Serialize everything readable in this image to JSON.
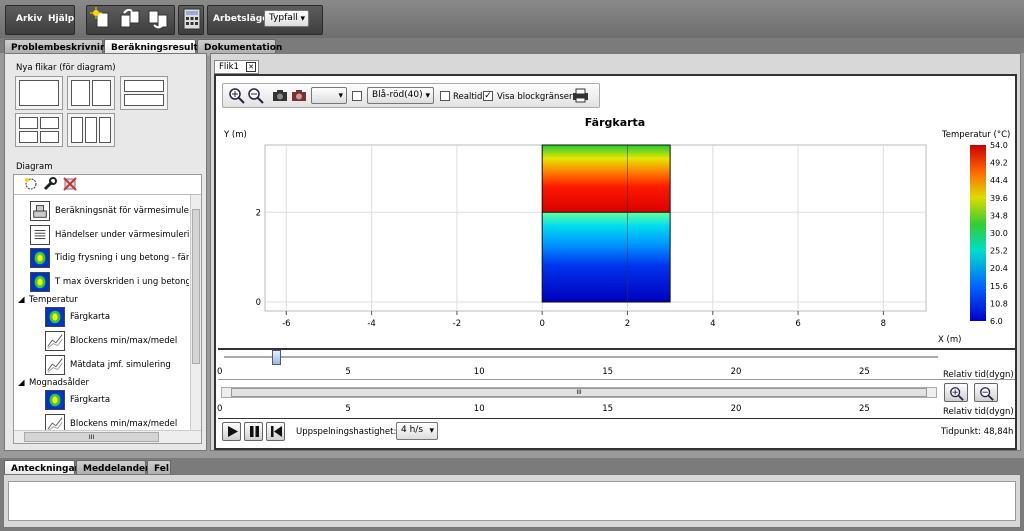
{
  "menu": {
    "arkiv": "Arkiv",
    "hjalp": "Hjälp",
    "arbetslage_label": "Arbetsläge:",
    "arbetslage_value": "Typfall"
  },
  "main_tabs": [
    {
      "label": "Problembeskrivning"
    },
    {
      "label": "Beräkningsresultat"
    },
    {
      "label": "Dokumentation"
    }
  ],
  "left": {
    "new_tabs_title": "Nya flikar (för diagram)",
    "diagram_title": "Diagram",
    "items": [
      {
        "label": "Beräkningsnät för värmesimulerin"
      },
      {
        "label": "Händelser under värmesimulering"
      },
      {
        "label": "Tidig frysning i ung betong - färgk"
      },
      {
        "label": "T max överskriden i ung betong -"
      }
    ],
    "cat_temp": "Temperatur",
    "temp_items": [
      {
        "label": "Färgkarta"
      },
      {
        "label": "Blockens min/max/medel"
      },
      {
        "label": "Mätdata jmf. simulering"
      }
    ],
    "cat_mogn": "Mognadsålder",
    "mogn_items": [
      {
        "label": "Färgkarta"
      },
      {
        "label": "Blockens min/max/medel"
      }
    ],
    "hscroll_grip": "III"
  },
  "doc_tab": {
    "label": "Flik1",
    "close": "✕"
  },
  "chart_toolbar": {
    "palette": "Blå-röd(40)",
    "realtid": "Realtid",
    "visa_block": "Visa blockgränser"
  },
  "chart_data": {
    "type": "heatmap",
    "title": "Färgkarta",
    "xlabel": "X (m)",
    "ylabel": "Y (m)",
    "xlim": [
      -6.5,
      9
    ],
    "ylim": [
      -0.2,
      3.5
    ],
    "x_ticks": [
      "-6",
      "-4",
      "-2",
      "0",
      "2",
      "4",
      "6",
      "8"
    ],
    "y_ticks": [
      "0",
      "2"
    ],
    "legend_title": "Temperatur (°C)",
    "legend_ticks": [
      "54.0",
      "49.2",
      "44.4",
      "39.6",
      "34.8",
      "30.0",
      "25.2",
      "20.4",
      "15.6",
      "10.8",
      "6.0"
    ],
    "block": {
      "x0": 0,
      "x1": 3,
      "y0": 0,
      "y1": 3.5,
      "vline_x": 2,
      "hline_y": 2
    }
  },
  "timeline": {
    "ticks": [
      "0",
      "5",
      "10",
      "15",
      "20",
      "25"
    ],
    "axis_label": "Relativ tid(dygn)",
    "slider_position_days": 2.2,
    "hscroll_grip": "III"
  },
  "playback": {
    "speed_label": "Uppspelningshastighet:",
    "speed_value": "4 h/s",
    "time_label": "Tidpunkt: 48,84h"
  },
  "bottom_tabs": [
    {
      "label": "Anteckningar"
    },
    {
      "label": "Meddelanden"
    },
    {
      "label": "Fel"
    }
  ],
  "colors": {
    "accent": "#0000cc",
    "cold": "#0000d0",
    "hot": "#cc0000"
  }
}
